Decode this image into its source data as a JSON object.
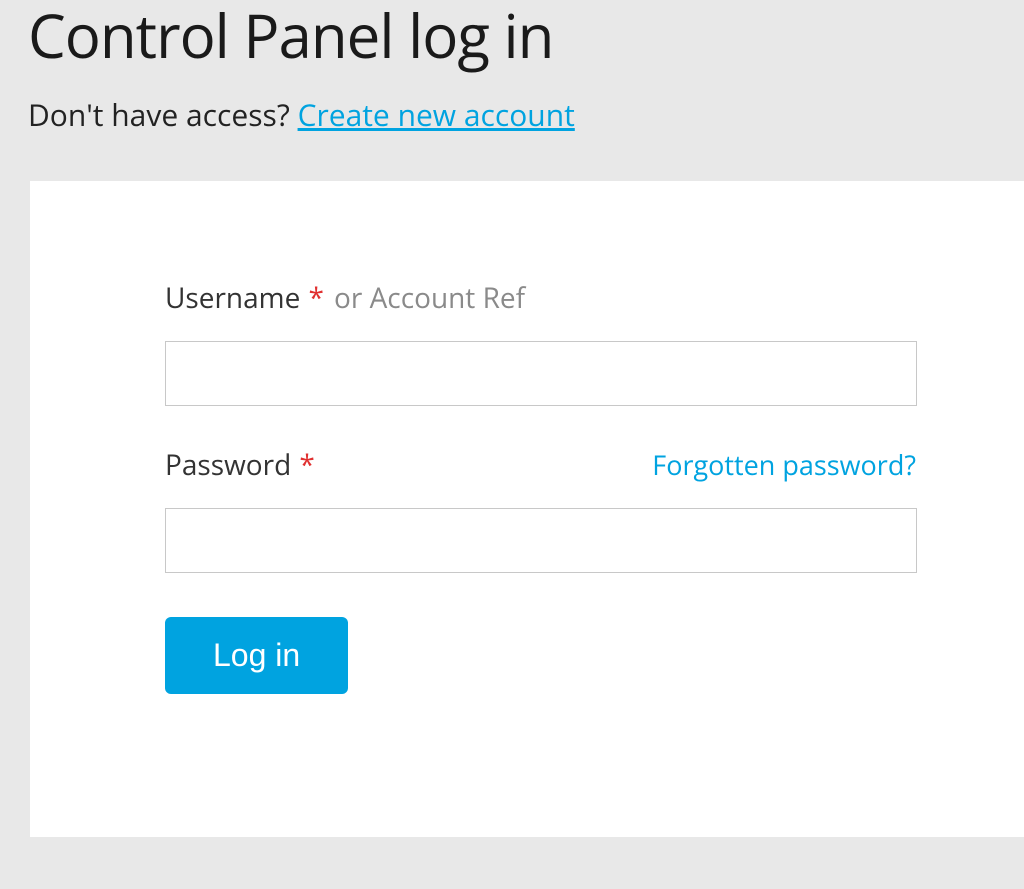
{
  "header": {
    "title": "Control Panel log in",
    "subtitle_prefix": "Don't have access? ",
    "create_account_link": "Create new account"
  },
  "form": {
    "username": {
      "label": "Username",
      "required_marker": "*",
      "hint": "or Account Ref",
      "value": ""
    },
    "password": {
      "label": "Password",
      "required_marker": "*",
      "forgot_link": "Forgotten password?",
      "value": ""
    },
    "submit_label": "Log in"
  },
  "colors": {
    "accent": "#00a3e0",
    "required": "#e03030",
    "page_bg": "#e8e8e8"
  }
}
